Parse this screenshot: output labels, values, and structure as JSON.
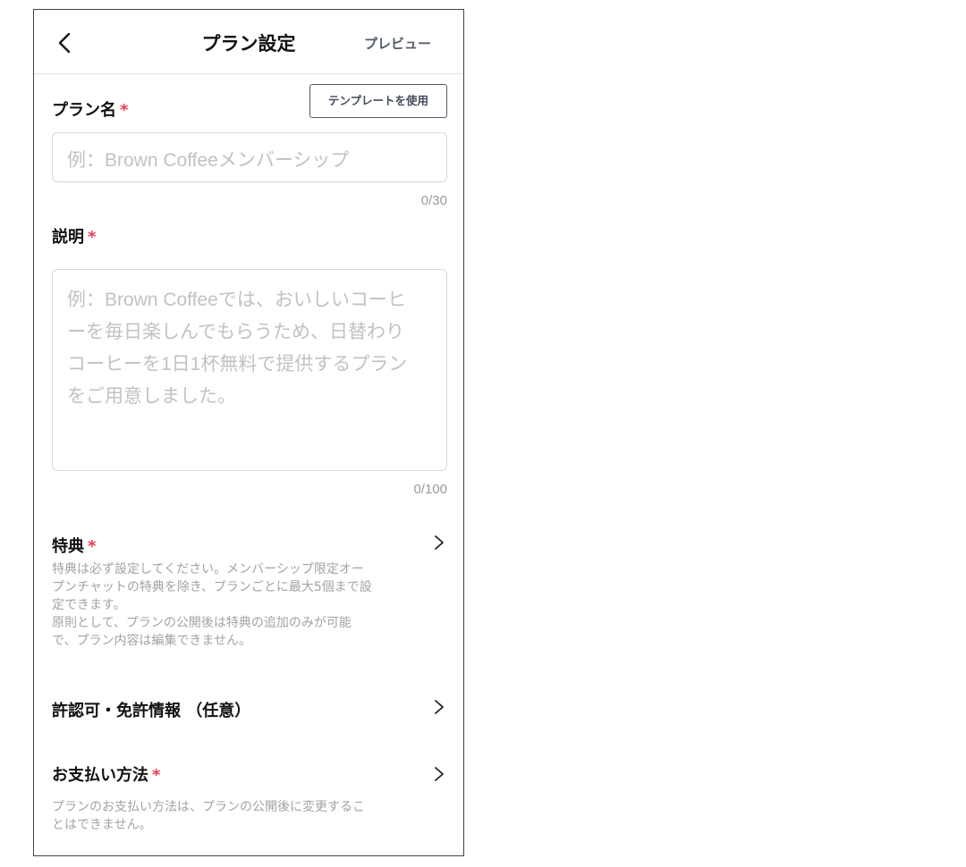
{
  "header": {
    "title": "プラン設定",
    "preview_label": "プレビュー",
    "back_icon": "chevron-left-icon"
  },
  "plan_name": {
    "label": "プラン名",
    "required_mark": "*",
    "template_button": "テンプレートを使用",
    "placeholder": "例：Brown Coffeeメンバーシップ",
    "value": "",
    "counter": "0/30"
  },
  "description": {
    "label": "説明",
    "required_mark": "*",
    "placeholder_lines": [
      "例：Brown Coffeeでは、おいしいコーヒ",
      "ーを毎日楽しんでもらうため、日替わり",
      "コーヒーを1日1杯無料で提供するプラン",
      "をご用意しました。"
    ],
    "value": "",
    "counter": "0/100"
  },
  "benefits": {
    "title": "特典",
    "required_mark": "*",
    "note_lines": [
      "特典は必ず設定してください。メンバーシップ限定オー",
      "プンチャットの特典を除き、プランごとに最大5個まで設",
      "定できます。",
      "原則として、プランの公開後は特典の追加のみが可能",
      "で、プラン内容は編集できません。"
    ]
  },
  "license": {
    "title": "許認可・免許情報 （任意）"
  },
  "payment": {
    "title": "お支払い方法",
    "required_mark": "*",
    "note_lines": [
      "プランのお支払い方法は、プランの公開後に変更するこ",
      "とはできません。"
    ]
  },
  "colors": {
    "required": "#ef3a55",
    "placeholder": "#c2c2c2",
    "note": "#a3a3a3",
    "border": "#d8d8d8"
  }
}
